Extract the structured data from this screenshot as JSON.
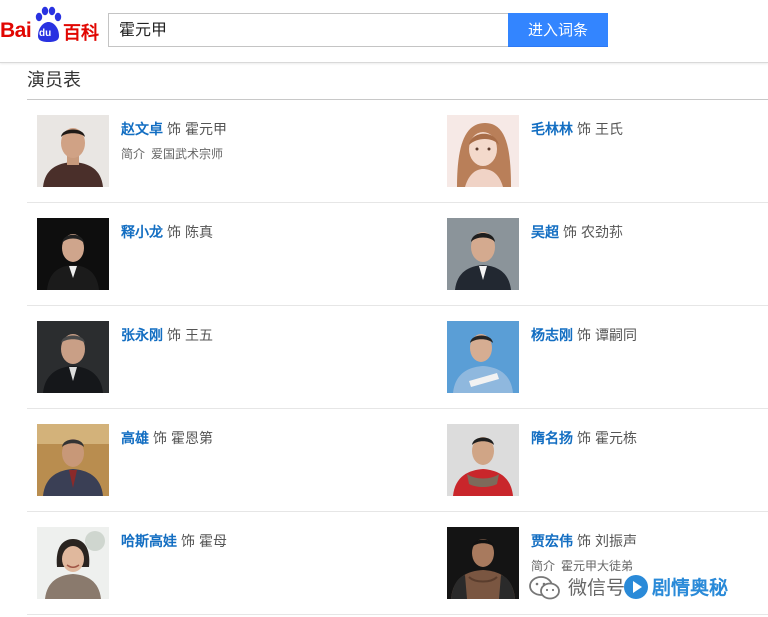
{
  "header": {
    "logo": {
      "bai": "Bai",
      "du": "du",
      "baike": "百科"
    },
    "search": {
      "value": "霍元甲"
    },
    "button_label": "进入词条"
  },
  "section": {
    "title": "演员表"
  },
  "connector": "饰",
  "intro_label": "简介",
  "cast": [
    {
      "actor": "赵文卓",
      "role": "霍元甲",
      "intro": "爱国武术宗师",
      "photo": "man-in-dark-shirt"
    },
    {
      "actor": "毛林林",
      "role": "王氏",
      "intro": "",
      "photo": "young-woman-portrait"
    },
    {
      "actor": "释小龙",
      "role": "陈真",
      "intro": "",
      "photo": "man-in-black-suit"
    },
    {
      "actor": "吴超",
      "role": "农劲荪",
      "intro": "",
      "photo": "man-in-suit"
    },
    {
      "actor": "张永刚",
      "role": "王五",
      "intro": "",
      "photo": "man-in-suit-dark"
    },
    {
      "actor": "杨志刚",
      "role": "谭嗣同",
      "intro": "",
      "photo": "man-blue-background"
    },
    {
      "actor": "高雄",
      "role": "霍恩第",
      "intro": "",
      "photo": "older-man-in-suit"
    },
    {
      "actor": "隋名扬",
      "role": "霍元栋",
      "intro": "",
      "photo": "man-in-red-shirt"
    },
    {
      "actor": "哈斯高娃",
      "role": "霍母",
      "intro": "",
      "photo": "smiling-woman"
    },
    {
      "actor": "贾宏伟",
      "role": "刘振声",
      "intro": "霍元甲大徒弟",
      "photo": "shirtless-man"
    }
  ],
  "watermark": {
    "text": "微信号",
    "brand": "剧情奥秘"
  }
}
